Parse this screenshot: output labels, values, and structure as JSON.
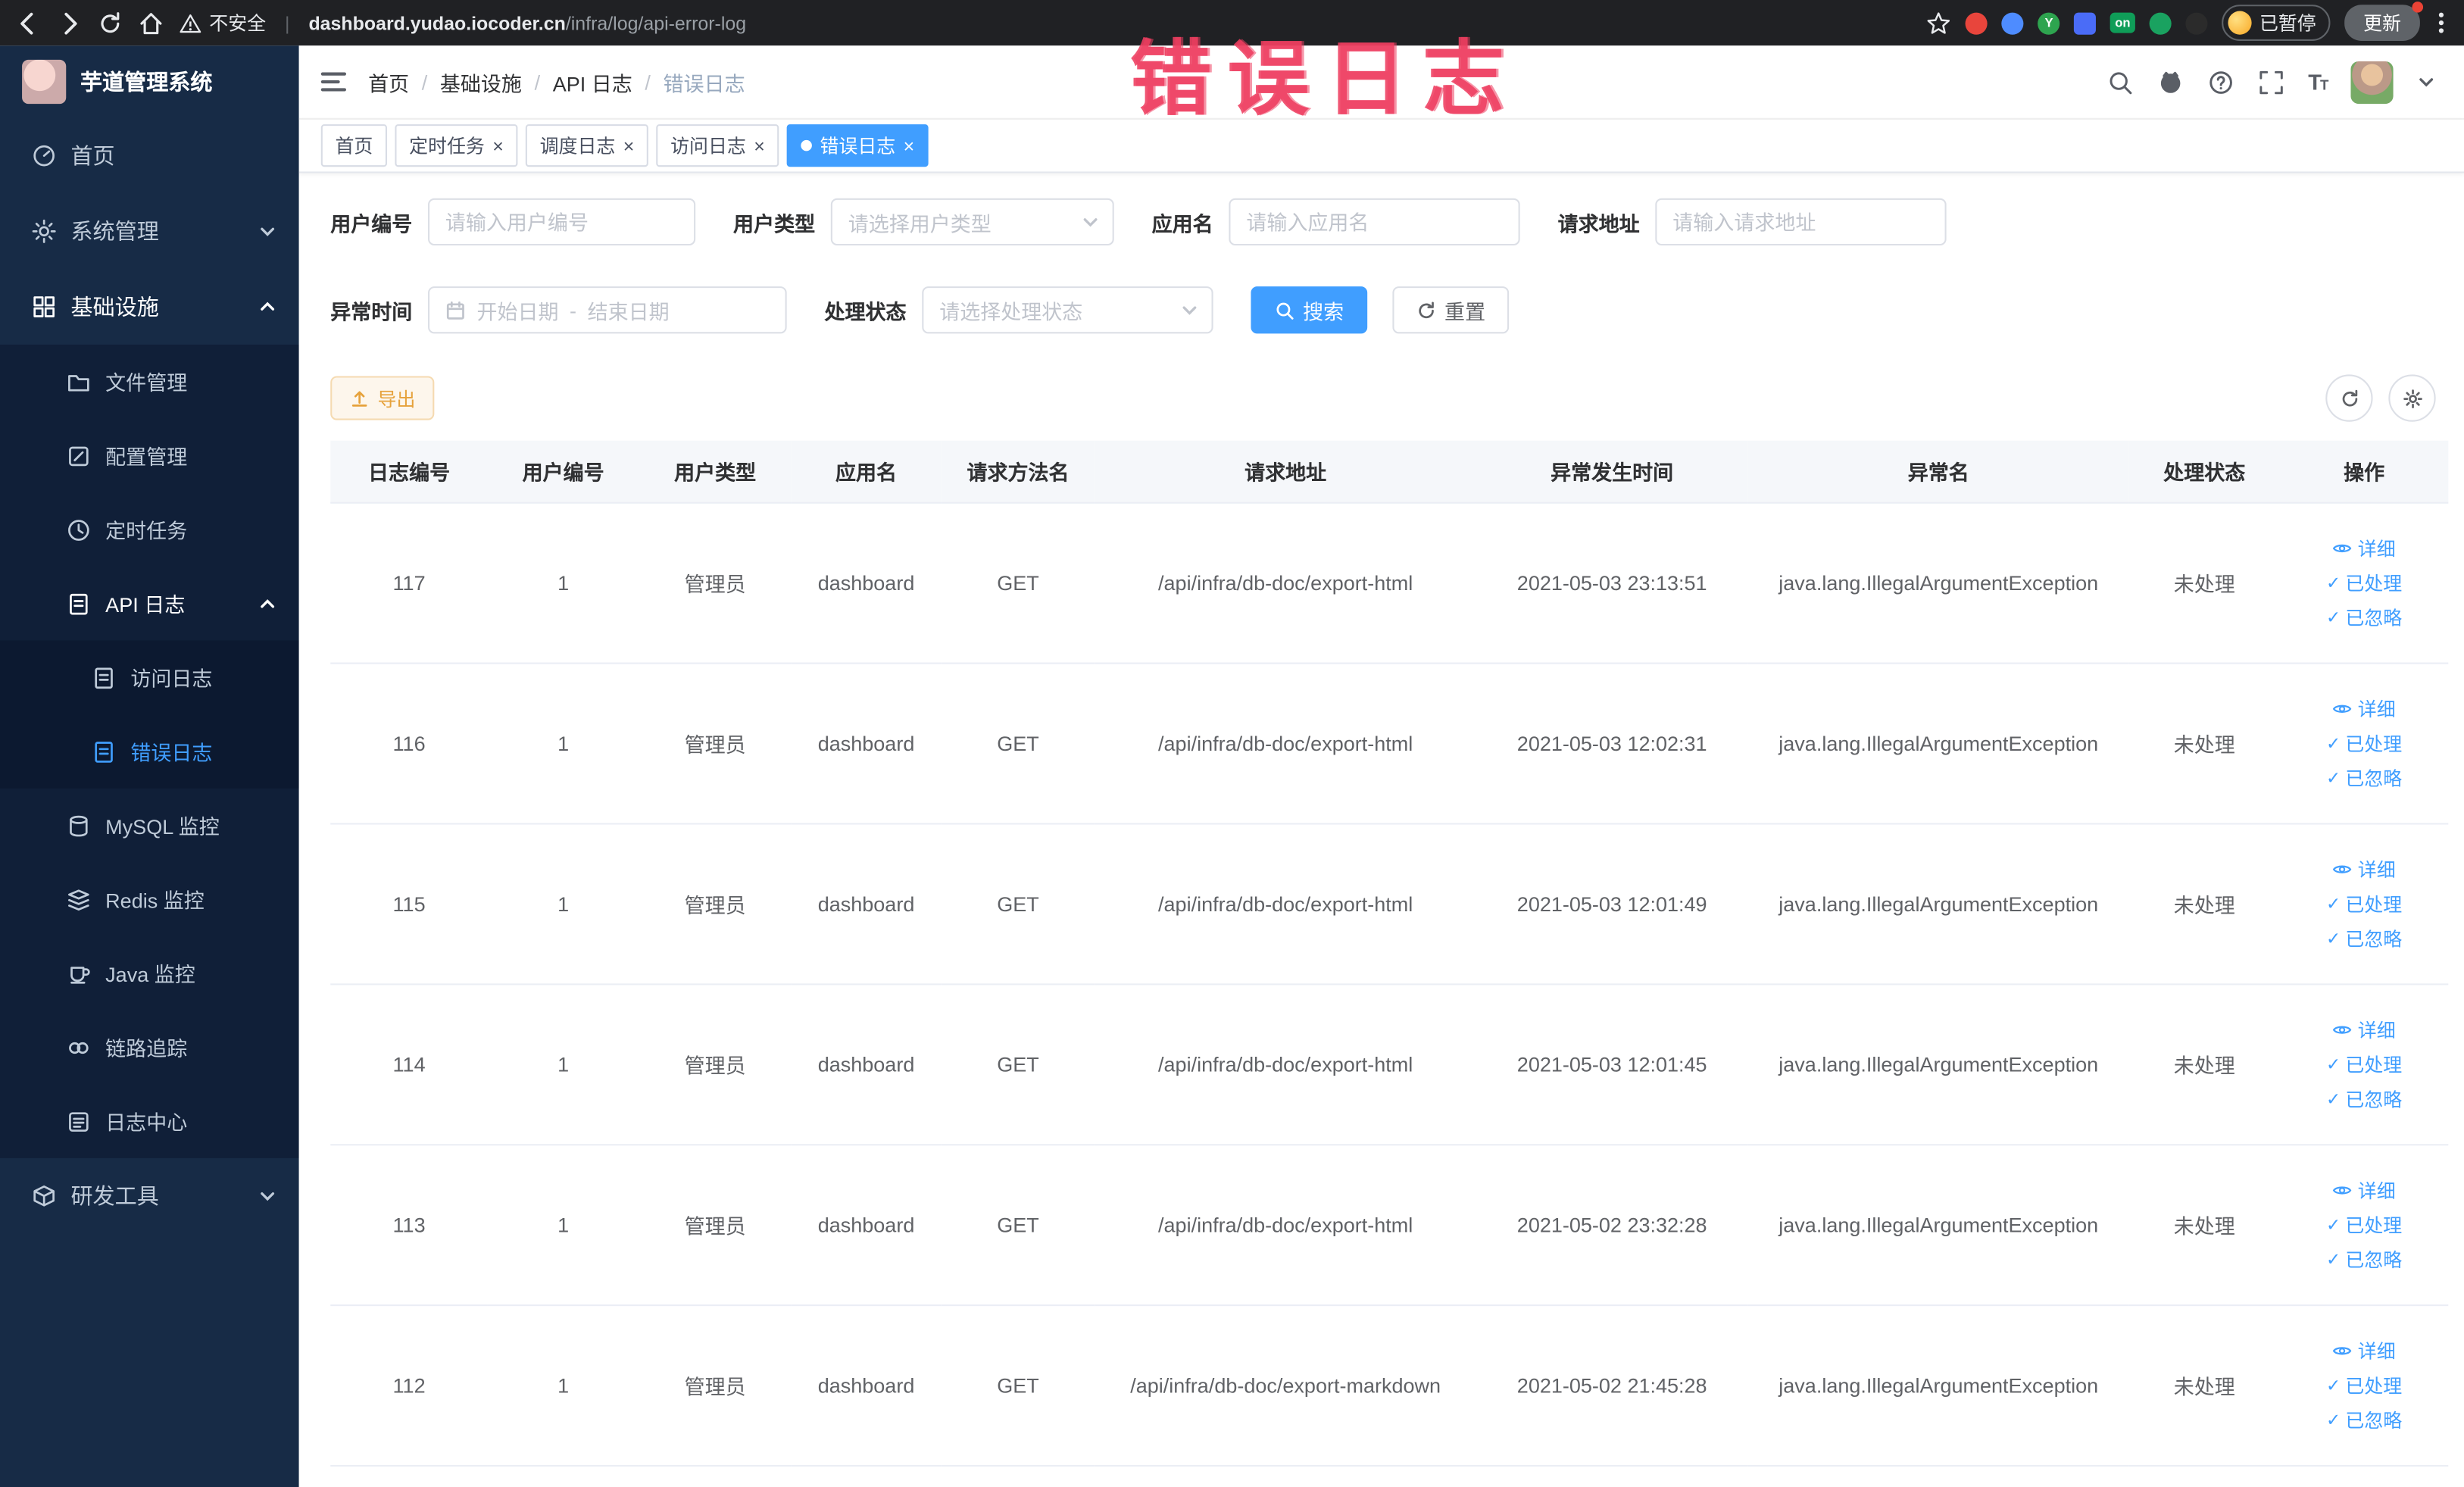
{
  "browser": {
    "security_label": "不安全",
    "url_host": "dashboard.yudao.iocoder.cn",
    "url_path": "/infra/log/api-error-log",
    "on_badge": "on",
    "paused_badge": "已暂停",
    "update_button": "更新"
  },
  "annotation": {
    "text": "错误日志"
  },
  "icons": {
    "close": "×",
    "check": "✓",
    "slash": "/",
    "pipe": "|",
    "range_sep": "-"
  },
  "sidebar": {
    "logo_title": "芋道管理系统",
    "home": "首页",
    "system": "系统管理",
    "infra": "基础设施",
    "file": "文件管理",
    "config": "配置管理",
    "job": "定时任务",
    "api_log": "API 日志",
    "access_log": "访问日志",
    "error_log": "错误日志",
    "mysql": "MySQL 监控",
    "redis": "Redis 监控",
    "java": "Java 监控",
    "trace": "链路追踪",
    "log_center": "日志中心",
    "dev_tools": "研发工具"
  },
  "header": {
    "breadcrumb": [
      "首页",
      "基础设施",
      "API 日志",
      "错误日志"
    ]
  },
  "tabs": [
    {
      "label": "首页"
    },
    {
      "label": "定时任务"
    },
    {
      "label": "调度日志"
    },
    {
      "label": "访问日志"
    },
    {
      "label": "错误日志"
    }
  ],
  "filters": {
    "user_id_label": "用户编号",
    "user_id_placeholder": "请输入用户编号",
    "user_type_label": "用户类型",
    "user_type_placeholder": "请选择用户类型",
    "app_name_label": "应用名",
    "app_name_placeholder": "请输入应用名",
    "request_url_label": "请求地址",
    "request_url_placeholder": "请输入请求地址",
    "exception_time_label": "异常时间",
    "start_date_placeholder": "开始日期",
    "end_date_placeholder": "结束日期",
    "process_status_label": "处理状态",
    "process_status_placeholder": "请选择处理状态",
    "search_button": "搜索",
    "reset_button": "重置"
  },
  "toolbar": {
    "export_button": "导出"
  },
  "table": {
    "columns": [
      "日志编号",
      "用户编号",
      "用户类型",
      "应用名",
      "请求方法名",
      "请求地址",
      "异常发生时间",
      "异常名",
      "处理状态",
      "操作"
    ],
    "actions": {
      "detail": "详细",
      "processed": "已处理",
      "ignored": "已忽略"
    },
    "rows": [
      {
        "id": "117",
        "user_id": "1",
        "user_type": "管理员",
        "app": "dashboard",
        "method": "GET",
        "url": "/api/infra/db-doc/export-html",
        "time": "2021-05-03 23:13:51",
        "exception": "java.lang.IllegalArgumentException",
        "status": "未处理"
      },
      {
        "id": "116",
        "user_id": "1",
        "user_type": "管理员",
        "app": "dashboard",
        "method": "GET",
        "url": "/api/infra/db-doc/export-html",
        "time": "2021-05-03 12:02:31",
        "exception": "java.lang.IllegalArgumentException",
        "status": "未处理"
      },
      {
        "id": "115",
        "user_id": "1",
        "user_type": "管理员",
        "app": "dashboard",
        "method": "GET",
        "url": "/api/infra/db-doc/export-html",
        "time": "2021-05-03 12:01:49",
        "exception": "java.lang.IllegalArgumentException",
        "status": "未处理"
      },
      {
        "id": "114",
        "user_id": "1",
        "user_type": "管理员",
        "app": "dashboard",
        "method": "GET",
        "url": "/api/infra/db-doc/export-html",
        "time": "2021-05-03 12:01:45",
        "exception": "java.lang.IllegalArgumentException",
        "status": "未处理"
      },
      {
        "id": "113",
        "user_id": "1",
        "user_type": "管理员",
        "app": "dashboard",
        "method": "GET",
        "url": "/api/infra/db-doc/export-html",
        "time": "2021-05-02 23:32:28",
        "exception": "java.lang.IllegalArgumentException",
        "status": "未处理"
      },
      {
        "id": "112",
        "user_id": "1",
        "user_type": "管理员",
        "app": "dashboard",
        "method": "GET",
        "url": "/api/infra/db-doc/export-markdown",
        "time": "2021-05-02 21:45:28",
        "exception": "java.lang.IllegalArgumentException",
        "status": "未处理"
      }
    ]
  },
  "colors": {
    "accent": "#409eff",
    "warning": "#e6a23c",
    "sidebar_bg": "#172b46",
    "annotation": "#ee3e60",
    "chrome_bg": "#202124"
  }
}
